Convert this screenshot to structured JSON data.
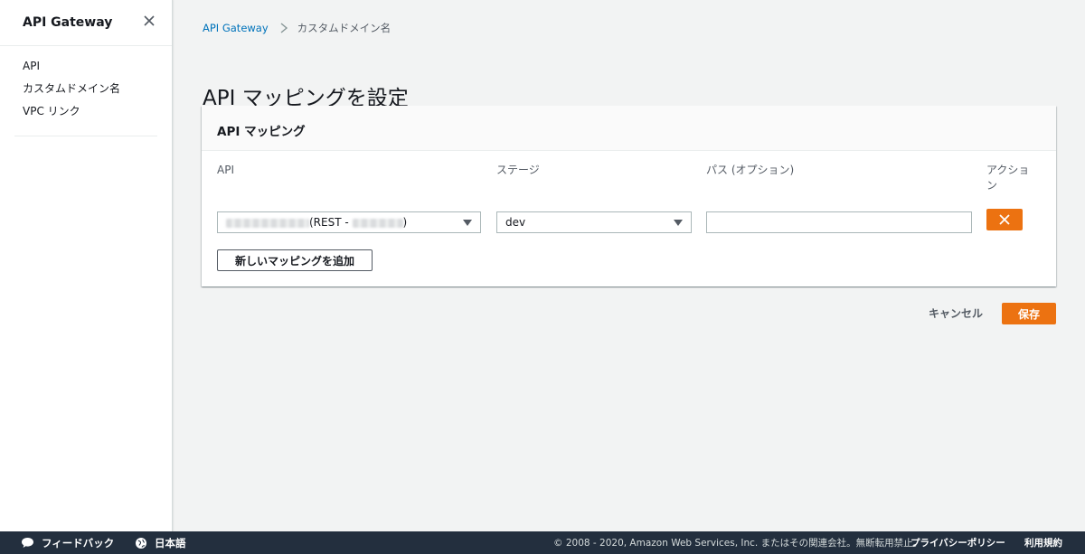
{
  "sidebar": {
    "title": "API Gateway",
    "items": [
      {
        "label": "API"
      },
      {
        "label": "カスタムドメイン名"
      },
      {
        "label": "VPC リンク"
      }
    ]
  },
  "breadcrumb": {
    "root": "API Gateway",
    "current": "カスタムドメイン名"
  },
  "page": {
    "title": "API マッピングを設定"
  },
  "panel": {
    "title": "API マッピング",
    "columns": {
      "api": "API",
      "stage": "ステージ",
      "path": "パス (オプション)",
      "action": "アクション"
    },
    "row": {
      "api_value_suffix": "(REST - ",
      "api_value_close": ")",
      "stage_value": "dev",
      "path_value": ""
    },
    "add_mapping_label": "新しいマッピングを追加"
  },
  "actions": {
    "cancel_label": "キャンセル",
    "save_label": "保存"
  },
  "footer": {
    "feedback": "フィードバック",
    "language": "日本語",
    "copyright": "© 2008 - 2020, Amazon Web Services, Inc. またはその関連会社。無断転用禁止。",
    "privacy": "プライバシーポリシー",
    "terms": "利用規約"
  },
  "colors": {
    "accent": "#ec7211",
    "link": "#0073bb",
    "footer_bg": "#232f3e"
  },
  "icons": {
    "close": "close-icon",
    "breadcrumb_separator": "chevron-right-icon",
    "dropdown": "caret-down-icon",
    "remove": "x-icon",
    "feedback": "speech-bubble-icon",
    "language": "globe-icon"
  }
}
